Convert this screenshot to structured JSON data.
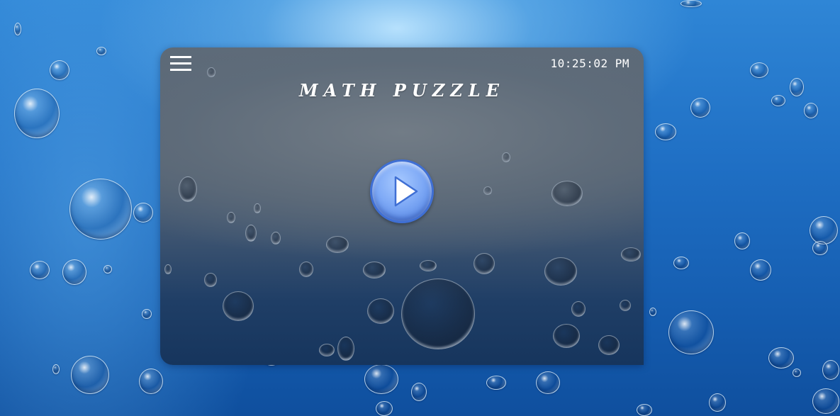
{
  "app": {
    "title": "MATH PUZZLE",
    "time": "10:25:02 PM"
  },
  "icons": {
    "menu": "hamburger-menu-icon",
    "play": "play-icon"
  },
  "colors": {
    "play_button": "#6f9ef0",
    "panel": "#566474",
    "text": "#ffffff"
  }
}
